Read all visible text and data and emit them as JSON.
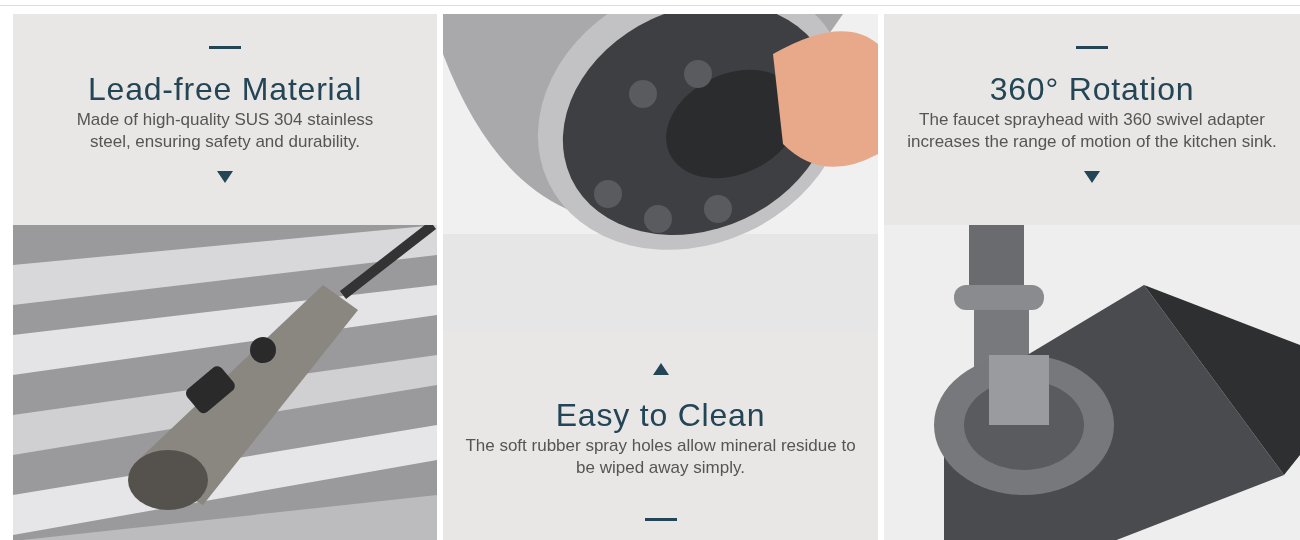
{
  "features": [
    {
      "kind": "text_top",
      "title": "Lead-free Material",
      "description": "Made of high-quality SUS 304 stainless steel, ensuring safety and durability."
    },
    {
      "kind": "text_bottom",
      "title": "Easy to Clean",
      "description": "The soft rubber spray holes allow mineral residue to be wiped away simply."
    },
    {
      "kind": "text_top",
      "title": "360° Rotation",
      "description": "The faucet sprayhead with 360 swivel adapter increases the range of motion of the kitchen sink."
    }
  ]
}
